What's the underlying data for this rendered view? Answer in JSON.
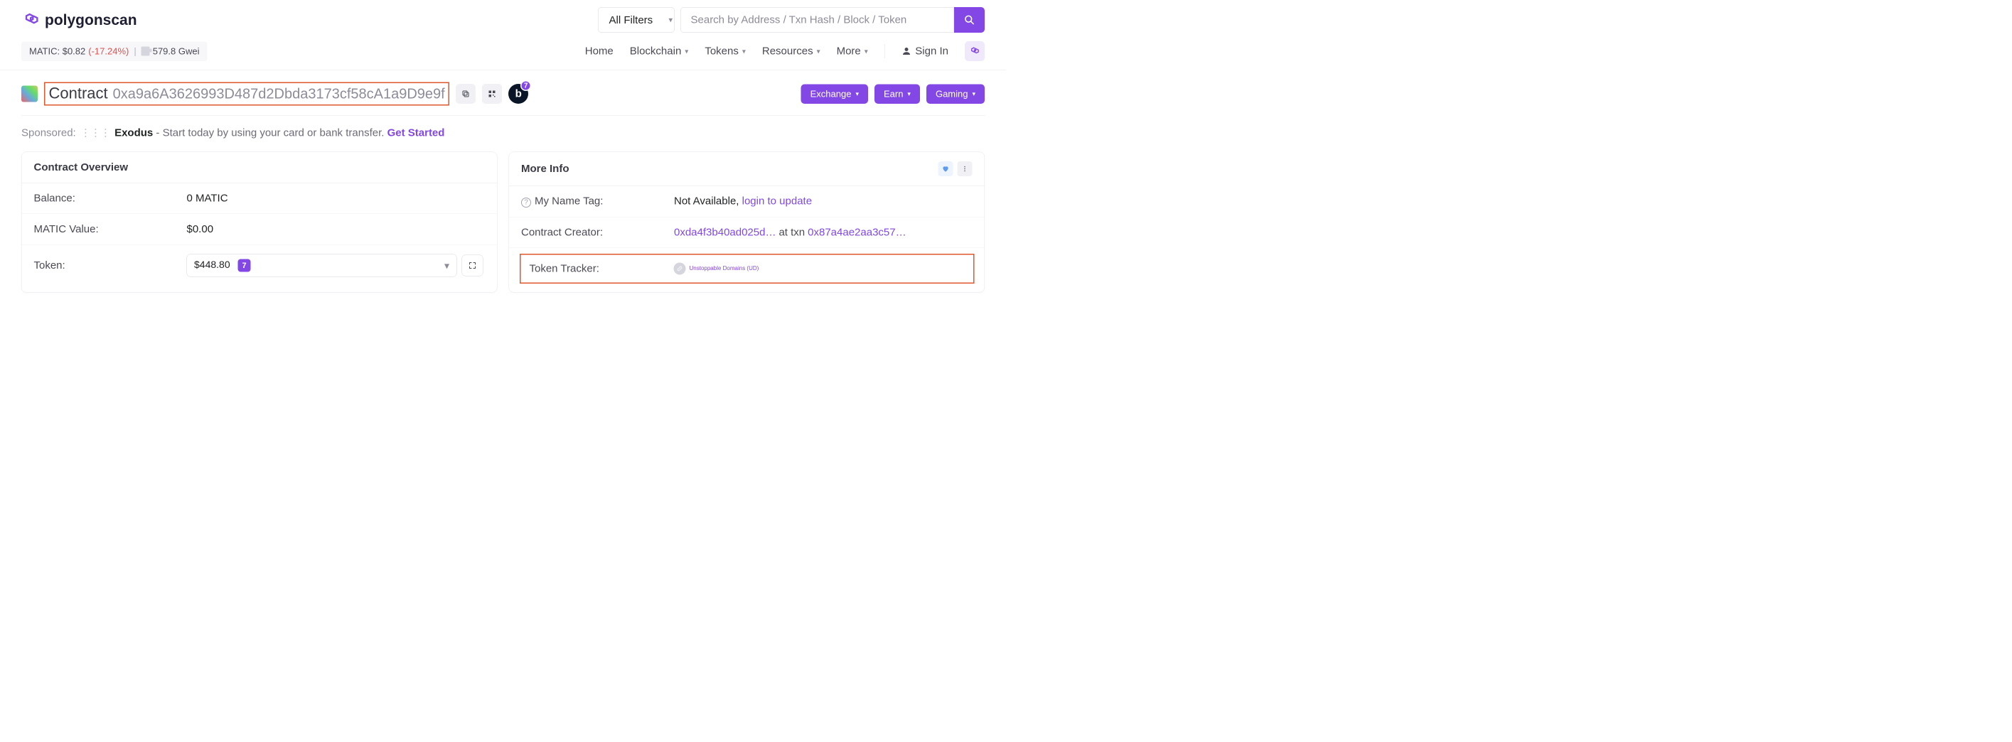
{
  "brand": "polygonscan",
  "price": {
    "label": "MATIC:",
    "value": "$0.82",
    "change": "(-17.24%)",
    "gas": "579.8 Gwei"
  },
  "search": {
    "filter": "All Filters",
    "placeholder": "Search by Address / Txn Hash / Block / Token"
  },
  "nav": {
    "home": "Home",
    "blockchain": "Blockchain",
    "tokens": "Tokens",
    "resources": "Resources",
    "more": "More",
    "signin": "Sign In"
  },
  "contract": {
    "label": "Contract",
    "address": "0xa9a6A3626993D487d2Dbda3173cf58cA1a9D9e9f",
    "badge_letter": "b",
    "badge_count": "7"
  },
  "actions": {
    "exchange": "Exchange",
    "earn": "Earn",
    "gaming": "Gaming"
  },
  "sponsored": {
    "prefix": "Sponsored:",
    "brand": "Exodus",
    "text": "- Start today by using your card or bank transfer.",
    "cta": "Get Started"
  },
  "overview": {
    "title": "Contract Overview",
    "balance_label": "Balance:",
    "balance_value": "0 MATIC",
    "value_label": "MATIC Value:",
    "value_value": "$0.00",
    "token_label": "Token:",
    "token_amount": "$448.80",
    "token_count": "7"
  },
  "moreinfo": {
    "title": "More Info",
    "nametag_label": "My Name Tag:",
    "nametag_value": "Not Available,",
    "nametag_link": "login to update",
    "creator_label": "Contract Creator:",
    "creator_addr": "0xda4f3b40ad025d…",
    "creator_at": "at txn",
    "creator_txn": "0x87a4ae2aa3c57…",
    "tracker_label": "Token Tracker:",
    "tracker_name": "Unstoppable Domains (UD)"
  }
}
